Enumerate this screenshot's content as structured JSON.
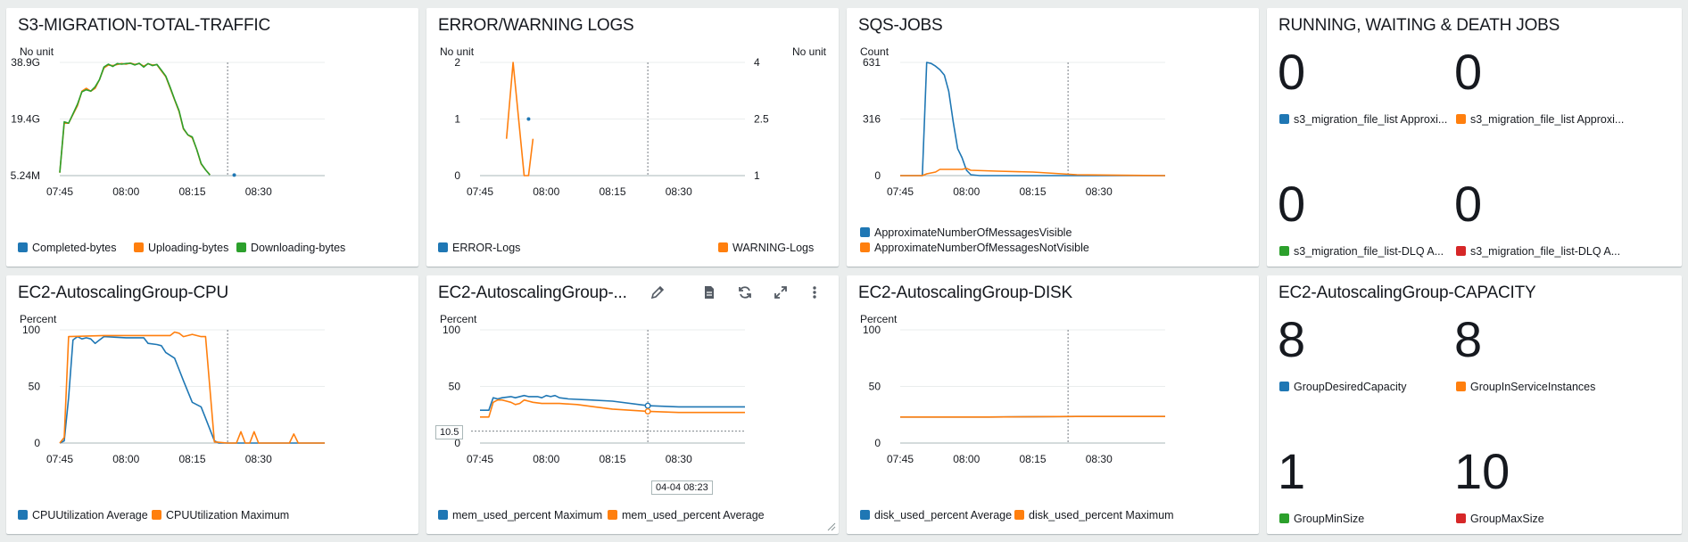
{
  "widgets": {
    "w1": {
      "title": "S3-MIGRATION-TOTAL-TRAFFIC",
      "unit_left": "No unit",
      "legend": [
        "Completed-bytes",
        "Uploading-bytes",
        "Downloading-bytes"
      ]
    },
    "w2": {
      "title": "ERROR/WARNING LOGS",
      "unit_left": "No unit",
      "unit_right": "No unit",
      "legend": [
        "ERROR-Logs",
        "WARNING-Logs"
      ]
    },
    "w3": {
      "title": "SQS-JOBS",
      "unit_left": "Count",
      "legend": [
        "ApproximateNumberOfMessagesVisible",
        "ApproximateNumberOfMessagesNotVisible"
      ]
    },
    "w4": {
      "title": "RUNNING, WAITING & DEATH JOBS",
      "numbers": [
        {
          "value": "0",
          "label": "s3_migration_file_list Approxi..."
        },
        {
          "value": "0",
          "label": "s3_migration_file_list Approxi..."
        },
        {
          "value": "0",
          "label": "s3_migration_file_list-DLQ A..."
        },
        {
          "value": "0",
          "label": "s3_migration_file_list-DLQ A..."
        }
      ]
    },
    "w5": {
      "title": "EC2-AutoscalingGroup-CPU",
      "unit_left": "Percent",
      "legend": [
        "CPUUtilization Average",
        "CPUUtilization Maximum"
      ]
    },
    "w6": {
      "title": "EC2-AutoscalingGroup-...",
      "unit_left": "Percent",
      "legend": [
        "mem_used_percent Maximum",
        "mem_used_percent Average"
      ],
      "tooltip_x": "04-04 08:23",
      "tooltip_y": "10.5"
    },
    "w7": {
      "title": "EC2-AutoscalingGroup-DISK",
      "unit_left": "Percent",
      "legend": [
        "disk_used_percent Average",
        "disk_used_percent Maximum"
      ]
    },
    "w8": {
      "title": "EC2-AutoscalingGroup-CAPACITY",
      "numbers": [
        {
          "value": "8",
          "label": "GroupDesiredCapacity"
        },
        {
          "value": "8",
          "label": "GroupInServiceInstances"
        },
        {
          "value": "1",
          "label": "GroupMinSize"
        },
        {
          "value": "10",
          "label": "GroupMaxSize"
        }
      ]
    }
  },
  "colors": {
    "blue": "#1f77b4",
    "orange": "#ff7f0e",
    "green": "#2ca02c",
    "red": "#d62728"
  },
  "icons": [
    "pencil-icon",
    "document-icon",
    "refresh-icon",
    "expand-icon",
    "more-vertical-icon"
  ],
  "chart_data": [
    {
      "id": "w1",
      "type": "line",
      "x_ticks": [
        "07:45",
        "08:00",
        "08:15",
        "08:30"
      ],
      "y_ticks": [
        "38.9G",
        "19.4G",
        "5.24M"
      ],
      "ylim": [
        0,
        38.9
      ],
      "xlim": [
        0,
        60
      ],
      "series": [
        {
          "name": "Completed-bytes",
          "color": "#1f77b4",
          "points": [
            [
              39.5,
              0.2
            ]
          ]
        },
        {
          "name": "Uploading-bytes",
          "color": "#ff7f0e",
          "points": [
            [
              0,
              1
            ],
            [
              1,
              18
            ],
            [
              2,
              18
            ],
            [
              4,
              24
            ],
            [
              5,
              29
            ],
            [
              6,
              30
            ],
            [
              7,
              29
            ],
            [
              8,
              30
            ],
            [
              9,
              33
            ],
            [
              10,
              37
            ],
            [
              11,
              38
            ],
            [
              12,
              37.8
            ],
            [
              13,
              38.2
            ],
            [
              14,
              38.5
            ],
            [
              15,
              38.3
            ],
            [
              16,
              38.7
            ],
            [
              17,
              38.2
            ],
            [
              18,
              38.5
            ],
            [
              19,
              37.6
            ],
            [
              20,
              38.4
            ],
            [
              21,
              38
            ],
            [
              22,
              38.1
            ],
            [
              23,
              36
            ],
            [
              24,
              34
            ],
            [
              25,
              30
            ],
            [
              26,
              26
            ],
            [
              27,
              22
            ],
            [
              28,
              16
            ],
            [
              29,
              14
            ],
            [
              30,
              13
            ],
            [
              31,
              9
            ],
            [
              32,
              4
            ],
            [
              33,
              2
            ],
            [
              34,
              0.3
            ]
          ]
        },
        {
          "name": "Downloading-bytes",
          "color": "#2ca02c",
          "points": [
            [
              0,
              1
            ],
            [
              1,
              18.5
            ],
            [
              2,
              18
            ],
            [
              4,
              24.5
            ],
            [
              5,
              28.8
            ],
            [
              6,
              29.5
            ],
            [
              7,
              29
            ],
            [
              8,
              30.5
            ],
            [
              9,
              33
            ],
            [
              10,
              37.3
            ],
            [
              11,
              38.3
            ],
            [
              12,
              37.5
            ],
            [
              13,
              38.5
            ],
            [
              14,
              38.3
            ],
            [
              15,
              38.5
            ],
            [
              16,
              38.6
            ],
            [
              17,
              38
            ],
            [
              18,
              38.6
            ],
            [
              19,
              37.3
            ],
            [
              20,
              38.5
            ],
            [
              21,
              37.8
            ],
            [
              22,
              38.2
            ],
            [
              23,
              36.2
            ],
            [
              24,
              34.2
            ],
            [
              25,
              30.3
            ],
            [
              26,
              26.2
            ],
            [
              27,
              22.3
            ],
            [
              28,
              16.2
            ],
            [
              29,
              14
            ],
            [
              30,
              13.3
            ],
            [
              31,
              9
            ],
            [
              32,
              4.2
            ],
            [
              33,
              2
            ],
            [
              34,
              0.2
            ]
          ]
        }
      ]
    },
    {
      "id": "w2",
      "type": "line",
      "x_ticks": [
        "07:45",
        "08:00",
        "08:15",
        "08:30"
      ],
      "y_ticks_left": [
        "2",
        "1",
        "0"
      ],
      "y_ticks_right": [
        "4",
        "2.5",
        "1"
      ],
      "ylim": [
        0,
        2
      ],
      "xlim": [
        0,
        60
      ],
      "series": [
        {
          "name": "ERROR-Logs",
          "color": "#1f77b4",
          "points": [
            [
              11,
              1
            ]
          ]
        },
        {
          "name": "WARNING-Logs",
          "color": "#ff7f0e",
          "points": [
            [
              6,
              0.65
            ],
            [
              7.5,
              2
            ],
            [
              10,
              0
            ],
            [
              11,
              0
            ],
            [
              12,
              0.65
            ]
          ]
        }
      ]
    },
    {
      "id": "w3",
      "type": "line",
      "x_ticks": [
        "07:45",
        "08:00",
        "08:15",
        "08:30"
      ],
      "y_ticks": [
        "631",
        "316",
        "0"
      ],
      "ylim": [
        0,
        631
      ],
      "xlim": [
        0,
        60
      ],
      "series": [
        {
          "name": "ApproximateNumberOfMessagesVisible",
          "color": "#1f77b4",
          "points": [
            [
              0,
              0
            ],
            [
              5,
              0
            ],
            [
              6,
              631
            ],
            [
              7,
              625
            ],
            [
              8,
              610
            ],
            [
              9,
              590
            ],
            [
              10,
              560
            ],
            [
              11,
              470
            ],
            [
              12,
              300
            ],
            [
              13,
              150
            ],
            [
              14,
              100
            ],
            [
              15,
              30
            ],
            [
              16,
              5
            ],
            [
              18,
              0
            ],
            [
              60,
              0
            ]
          ]
        },
        {
          "name": "ApproximateNumberOfMessagesNotVisible",
          "color": "#ff7f0e",
          "points": [
            [
              0,
              0
            ],
            [
              5,
              0
            ],
            [
              6,
              10
            ],
            [
              8,
              20
            ],
            [
              9,
              35
            ],
            [
              12,
              35
            ],
            [
              14,
              35
            ],
            [
              15,
              40
            ],
            [
              16,
              30
            ],
            [
              22,
              25
            ],
            [
              30,
              20
            ],
            [
              40,
              5
            ],
            [
              50,
              2
            ],
            [
              60,
              0
            ]
          ]
        }
      ]
    },
    {
      "id": "w5",
      "type": "line",
      "x_ticks": [
        "07:45",
        "08:00",
        "08:15",
        "08:30"
      ],
      "y_ticks": [
        "100",
        "50",
        "0"
      ],
      "ylim": [
        0,
        100
      ],
      "xlim": [
        0,
        60
      ],
      "series": [
        {
          "name": "CPUUtilization Average",
          "color": "#1f77b4",
          "points": [
            [
              0,
              0
            ],
            [
              1,
              2
            ],
            [
              2,
              40
            ],
            [
              3,
              91
            ],
            [
              4,
              94
            ],
            [
              5,
              92
            ],
            [
              6,
              93
            ],
            [
              7,
              92
            ],
            [
              8,
              88
            ],
            [
              9,
              91
            ],
            [
              10,
              94
            ],
            [
              15,
              93
            ],
            [
              19,
              93
            ],
            [
              20,
              88
            ],
            [
              22,
              87
            ],
            [
              23,
              86
            ],
            [
              24,
              80
            ],
            [
              26,
              75
            ],
            [
              27,
              65
            ],
            [
              28,
              55
            ],
            [
              30,
              36
            ],
            [
              32,
              32
            ],
            [
              33,
              22
            ],
            [
              35,
              2
            ],
            [
              36,
              0
            ],
            [
              60,
              0
            ]
          ]
        },
        {
          "name": "CPUUtilization Maximum",
          "color": "#ff7f0e",
          "points": [
            [
              0,
              0
            ],
            [
              1,
              5
            ],
            [
              2,
              94
            ],
            [
              10,
              95
            ],
            [
              20,
              95
            ],
            [
              25,
              95
            ],
            [
              26,
              98
            ],
            [
              27,
              97
            ],
            [
              28,
              94
            ],
            [
              29,
              95
            ],
            [
              30,
              96
            ],
            [
              32,
              94
            ],
            [
              33,
              94
            ],
            [
              35,
              1
            ],
            [
              38,
              0
            ],
            [
              40,
              0
            ],
            [
              41,
              10
            ],
            [
              42,
              0
            ],
            [
              43,
              0
            ],
            [
              44,
              10
            ],
            [
              45,
              0
            ],
            [
              52,
              0
            ],
            [
              53,
              8
            ],
            [
              54,
              0
            ],
            [
              60,
              0
            ]
          ]
        }
      ]
    },
    {
      "id": "w6",
      "type": "line",
      "x_ticks": [
        "07:45",
        "08:00",
        "08:15",
        "08:30"
      ],
      "y_ticks": [
        "100",
        "50",
        "10.5",
        "0"
      ],
      "ylim": [
        0,
        100
      ],
      "xlim": [
        0,
        60
      ],
      "series": [
        {
          "name": "mem_used_percent Maximum",
          "color": "#1f77b4",
          "points": [
            [
              0,
              29
            ],
            [
              2,
              29
            ],
            [
              3,
              40
            ],
            [
              4,
              39
            ],
            [
              5,
              40
            ],
            [
              7,
              41
            ],
            [
              8,
              40
            ],
            [
              10,
              42
            ],
            [
              11,
              41
            ],
            [
              13,
              41
            ],
            [
              14,
              40
            ],
            [
              15,
              42
            ],
            [
              16,
              41
            ],
            [
              17,
              42
            ],
            [
              18,
              40
            ],
            [
              20,
              39
            ],
            [
              25,
              38
            ],
            [
              30,
              37
            ],
            [
              38,
              33
            ],
            [
              45,
              32
            ],
            [
              60,
              32
            ]
          ]
        },
        {
          "name": "mem_used_percent Average",
          "color": "#ff7f0e",
          "points": [
            [
              0,
              23
            ],
            [
              2,
              23
            ],
            [
              3,
              36
            ],
            [
              4,
              38
            ],
            [
              5,
              38
            ],
            [
              6,
              37
            ],
            [
              7,
              36
            ],
            [
              8,
              34
            ],
            [
              9,
              35
            ],
            [
              10,
              38
            ],
            [
              11,
              37
            ],
            [
              12,
              36
            ],
            [
              14,
              35
            ],
            [
              16,
              35
            ],
            [
              18,
              35
            ],
            [
              22,
              34
            ],
            [
              26,
              32
            ],
            [
              30,
              30
            ],
            [
              38,
              28
            ],
            [
              45,
              27
            ],
            [
              60,
              27
            ]
          ]
        }
      ]
    },
    {
      "id": "w7",
      "type": "line",
      "x_ticks": [
        "07:45",
        "08:00",
        "08:15",
        "08:30"
      ],
      "y_ticks": [
        "100",
        "50",
        "0"
      ],
      "ylim": [
        0,
        100
      ],
      "xlim": [
        0,
        60
      ],
      "series": [
        {
          "name": "disk_used_percent Average",
          "color": "#1f77b4",
          "points": [
            [
              0,
              23
            ],
            [
              20,
              23
            ],
            [
              40,
              23.5
            ],
            [
              60,
              23.5
            ]
          ]
        },
        {
          "name": "disk_used_percent Maximum",
          "color": "#ff7f0e",
          "points": [
            [
              0,
              23
            ],
            [
              20,
              23
            ],
            [
              40,
              23.5
            ],
            [
              60,
              23.5
            ]
          ]
        }
      ]
    }
  ]
}
